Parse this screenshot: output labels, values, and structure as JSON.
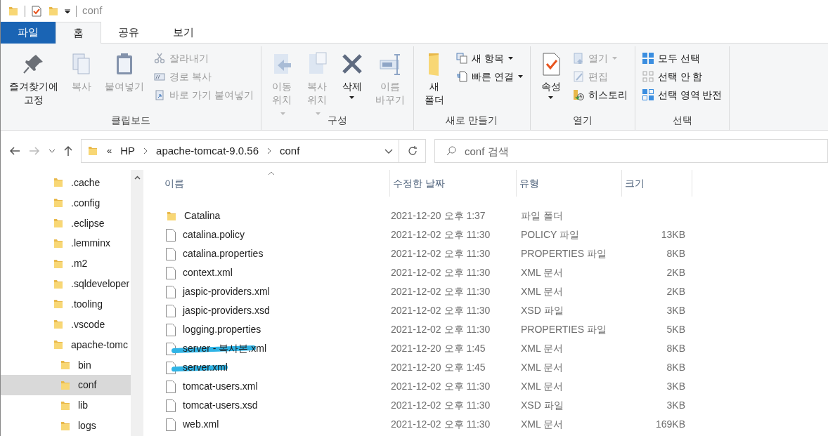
{
  "window": {
    "title": "conf"
  },
  "ribbon_tabs": [
    {
      "label": "파일",
      "kind": "file",
      "selected": false
    },
    {
      "label": "홈",
      "kind": "tab",
      "selected": true
    },
    {
      "label": "공유",
      "kind": "tab",
      "selected": false
    },
    {
      "label": "보기",
      "kind": "tab",
      "selected": false
    }
  ],
  "ribbon_groups": [
    {
      "label": "클립보드",
      "items": [
        {
          "kind": "large",
          "label": "즐겨찾기에 고정",
          "disabled": false
        },
        {
          "kind": "large",
          "label": "복사",
          "disabled": true
        },
        {
          "kind": "large",
          "label": "붙여넣기",
          "disabled": true
        },
        {
          "kind": "small",
          "label": "잘라내기",
          "disabled": true
        },
        {
          "kind": "small",
          "label": "경로 복사",
          "disabled": true
        },
        {
          "kind": "small",
          "label": "바로 가기 붙여넣기",
          "disabled": true
        }
      ]
    },
    {
      "label": "구성",
      "items": [
        {
          "kind": "large-split",
          "label": "이동 위치",
          "disabled": true
        },
        {
          "kind": "large-split",
          "label": "복사 위치",
          "disabled": true
        },
        {
          "kind": "large-menu",
          "label": "삭제",
          "disabled": false
        },
        {
          "kind": "large",
          "label": "이름 바꾸기",
          "disabled": true
        }
      ]
    },
    {
      "label": "새로 만들기",
      "items": [
        {
          "kind": "large",
          "label": "새 폴더",
          "disabled": false
        },
        {
          "kind": "small-menu",
          "label": "새 항목",
          "disabled": false
        },
        {
          "kind": "small-menu",
          "label": "빠른 연결",
          "disabled": false
        }
      ]
    },
    {
      "label": "열기",
      "items": [
        {
          "kind": "large-menu",
          "label": "속성",
          "disabled": false
        },
        {
          "kind": "small-menu",
          "label": "열기",
          "disabled": true
        },
        {
          "kind": "small",
          "label": "편집",
          "disabled": true
        },
        {
          "kind": "small",
          "label": "히스토리",
          "disabled": false
        }
      ]
    },
    {
      "label": "선택",
      "items": [
        {
          "kind": "small",
          "label": "모두 선택",
          "disabled": false
        },
        {
          "kind": "small",
          "label": "선택 안 함",
          "disabled": false
        },
        {
          "kind": "small",
          "label": "선택 영역 반전",
          "disabled": false
        }
      ]
    }
  ],
  "address_bar": {
    "overflow": "«",
    "breadcrumbs": [
      "HP",
      "apache-tomcat-9.0.56",
      "conf"
    ]
  },
  "search": {
    "placeholder": "conf 검색"
  },
  "nav_tree": [
    {
      "label": ".cache",
      "selected": false
    },
    {
      "label": ".config",
      "selected": false
    },
    {
      "label": ".eclipse",
      "selected": false
    },
    {
      "label": ".lemminx",
      "selected": false
    },
    {
      "label": ".m2",
      "selected": false
    },
    {
      "label": ".sqldeveloper",
      "selected": false
    },
    {
      "label": ".tooling",
      "selected": false
    },
    {
      "label": ".vscode",
      "selected": false
    },
    {
      "label": "apache-tomc",
      "selected": false,
      "children": [
        {
          "label": "bin",
          "selected": false
        },
        {
          "label": "conf",
          "selected": true
        },
        {
          "label": "lib",
          "selected": false
        },
        {
          "label": "logs",
          "selected": false
        }
      ]
    }
  ],
  "file_list": {
    "columns": [
      "이름",
      "수정한 날짜",
      "유형",
      "크기"
    ],
    "rows": [
      {
        "kind": "folder",
        "name": "Catalina",
        "date": "2021-12-20 오후 1:37",
        "type": "파일 폴더",
        "size": "",
        "highlighted": false
      },
      {
        "kind": "file",
        "name": "catalina.policy",
        "date": "2021-12-02 오후 11:30",
        "type": "POLICY 파일",
        "size": "13KB",
        "highlighted": false
      },
      {
        "kind": "file",
        "name": "catalina.properties",
        "date": "2021-12-02 오후 11:30",
        "type": "PROPERTIES 파일",
        "size": "8KB",
        "highlighted": false
      },
      {
        "kind": "file",
        "name": "context.xml",
        "date": "2021-12-02 오후 11:30",
        "type": "XML 문서",
        "size": "2KB",
        "highlighted": false
      },
      {
        "kind": "file",
        "name": "jaspic-providers.xml",
        "date": "2021-12-02 오후 11:30",
        "type": "XML 문서",
        "size": "2KB",
        "highlighted": false
      },
      {
        "kind": "file",
        "name": "jaspic-providers.xsd",
        "date": "2021-12-02 오후 11:30",
        "type": "XSD 파일",
        "size": "3KB",
        "highlighted": false
      },
      {
        "kind": "file",
        "name": "logging.properties",
        "date": "2021-12-02 오후 11:30",
        "type": "PROPERTIES 파일",
        "size": "5KB",
        "highlighted": false
      },
      {
        "kind": "file",
        "name": "server - 복사본.xml",
        "date": "2021-12-20 오후 1:45",
        "type": "XML 문서",
        "size": "8KB",
        "highlighted": true
      },
      {
        "kind": "file",
        "name": "server.xml",
        "date": "2021-12-20 오후 1:45",
        "type": "XML 문서",
        "size": "8KB",
        "highlighted": true
      },
      {
        "kind": "file",
        "name": "tomcat-users.xml",
        "date": "2021-12-02 오후 11:30",
        "type": "XML 문서",
        "size": "3KB",
        "highlighted": false
      },
      {
        "kind": "file",
        "name": "tomcat-users.xsd",
        "date": "2021-12-02 오후 11:30",
        "type": "XSD 파일",
        "size": "3KB",
        "highlighted": false
      },
      {
        "kind": "file",
        "name": "web.xml",
        "date": "2021-12-02 오후 11:30",
        "type": "XML 문서",
        "size": "169KB",
        "highlighted": false
      }
    ]
  }
}
